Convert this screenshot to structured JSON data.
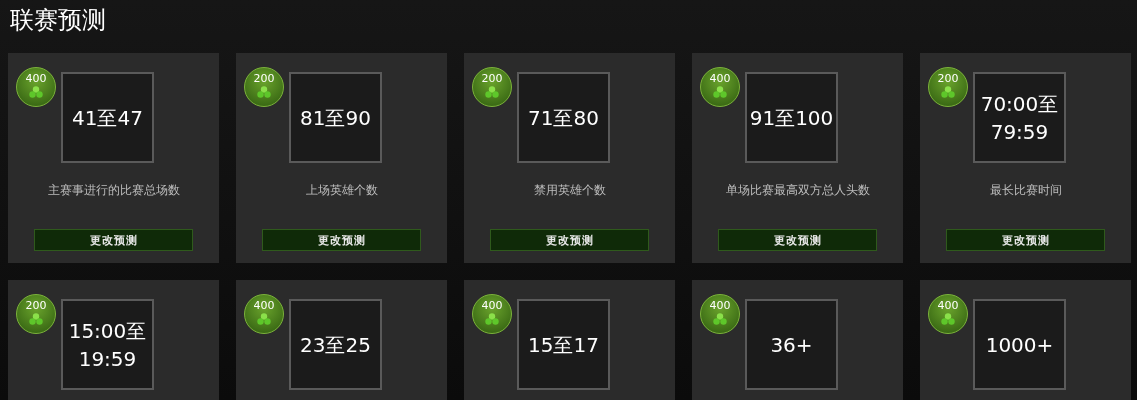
{
  "title": "联赛预测",
  "cards": [
    {
      "points": "400",
      "value": "41至47",
      "label": "主赛事进行的比赛总场数",
      "button": "更改预测"
    },
    {
      "points": "200",
      "value": "81至90",
      "label": "上场英雄个数",
      "button": "更改预测"
    },
    {
      "points": "200",
      "value": "71至80",
      "label": "禁用英雄个数",
      "button": "更改预测"
    },
    {
      "points": "400",
      "value": "91至100",
      "label": "单场比赛最高双方总人头数",
      "button": "更改预测"
    },
    {
      "points": "200",
      "value": "70:00至 79:59",
      "label": "最长比赛时间",
      "button": "更改预测"
    },
    {
      "points": "200",
      "value": "15:00至 19:59"
    },
    {
      "points": "400",
      "value": "23至25"
    },
    {
      "points": "400",
      "value": "15至17"
    },
    {
      "points": "400",
      "value": "36+"
    },
    {
      "points": "400",
      "value": "1000+"
    }
  ]
}
